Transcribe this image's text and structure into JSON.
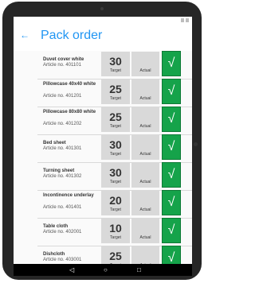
{
  "header": {
    "back_icon": "←",
    "title": "Pack order"
  },
  "labels": {
    "target": "Target",
    "actual": "Actual",
    "check_icon": "√"
  },
  "items": [
    {
      "name": "Duvet cover white",
      "article": "Article no. 401101",
      "target": "30"
    },
    {
      "name": "Pillowcase 40x40 white",
      "article": "Article no. 401201",
      "target": "25"
    },
    {
      "name": "Pillowcase 80x80 white",
      "article": "Article no. 401202",
      "target": "25"
    },
    {
      "name": "Bed sheet",
      "article": "Article no. 401301",
      "target": "30"
    },
    {
      "name": "Turning sheet",
      "article": "Article no. 401302",
      "target": "30"
    },
    {
      "name": "Incontinence underlay",
      "article": "Article no. 401401",
      "target": "20"
    },
    {
      "name": "Table cloth",
      "article": "Article no. 402001",
      "target": "10"
    },
    {
      "name": "Dishcloth",
      "article": "Article no. 403001",
      "target": "25"
    }
  ],
  "nav": {
    "back_icon": "◁",
    "home_icon": "○",
    "recent_icon": "□"
  },
  "colors": {
    "accent": "#2196f3",
    "check_green": "#15a34a",
    "box_grey": "#d9d9d9"
  }
}
